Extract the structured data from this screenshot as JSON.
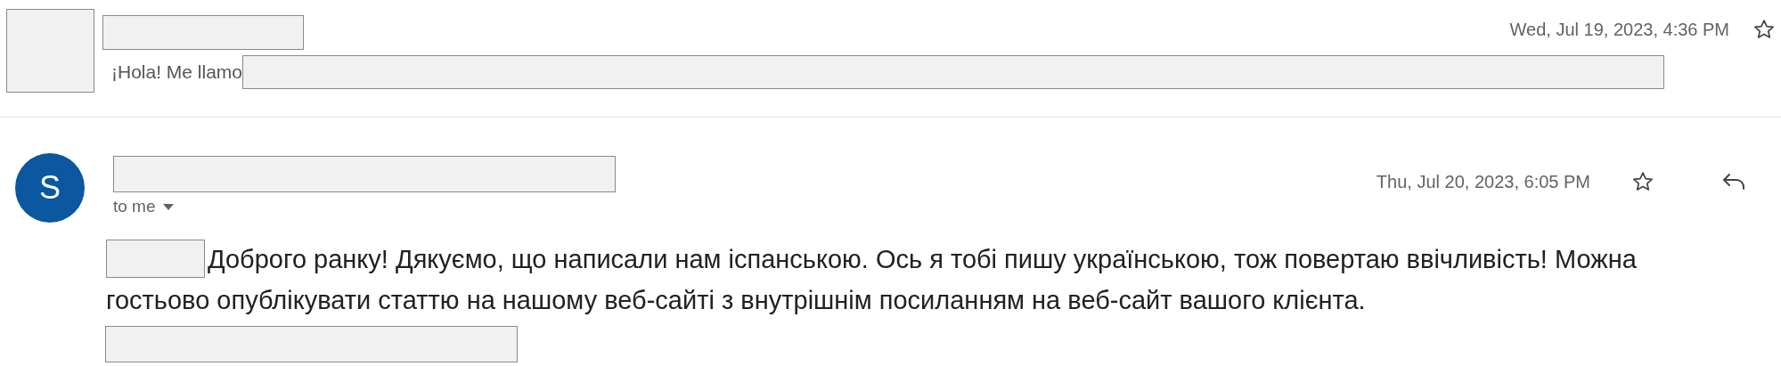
{
  "messages": [
    {
      "kind": "collapsed",
      "avatar": {
        "kind": "redacted"
      },
      "snippet": "¡Hola! Me llamo",
      "date": "Wed, Jul 19, 2023, 4:36 PM"
    },
    {
      "kind": "expanded",
      "avatar": {
        "kind": "initial",
        "initial": "S",
        "color": "#0b57a0"
      },
      "recipient": "to me",
      "date": "Thu, Jul 20, 2023, 6:05 PM",
      "body_lines": [
        "Доброго ранку! Дякуємо, що написали нам іспанською. Ось я тобі пишу українською, тож повертаю ввічливість! Можна",
        "гостьово опублікувати статтю на нашому веб-сайті з внутрішнім посиланням на веб-сайт вашого клієнта."
      ]
    }
  ]
}
